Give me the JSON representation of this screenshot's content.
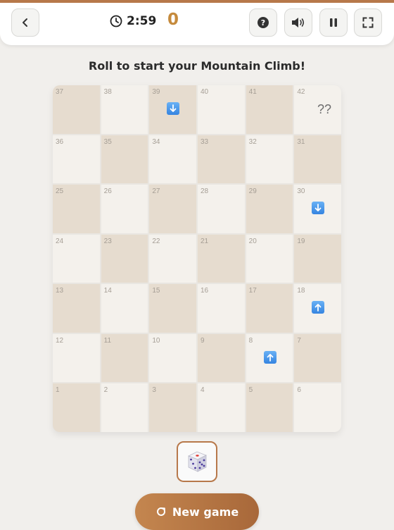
{
  "header": {
    "timer": "2:59",
    "score": "0",
    "back_icon": "chevron-left-icon",
    "help_icon": "question-icon",
    "sound_icon": "speaker-icon",
    "pause_icon": "pause-icon",
    "fullscreen_icon": "fullscreen-icon"
  },
  "message": "Roll to start your Mountain Climb!",
  "board": {
    "rows": [
      [
        {
          "n": "37",
          "dark": true
        },
        {
          "n": "38",
          "dark": false
        },
        {
          "n": "39",
          "dark": true,
          "arrow": "down"
        },
        {
          "n": "40",
          "dark": false
        },
        {
          "n": "41",
          "dark": true
        },
        {
          "n": "42",
          "dark": false,
          "label": "??"
        }
      ],
      [
        {
          "n": "36",
          "dark": false
        },
        {
          "n": "35",
          "dark": true
        },
        {
          "n": "34",
          "dark": false
        },
        {
          "n": "33",
          "dark": true
        },
        {
          "n": "32",
          "dark": false
        },
        {
          "n": "31",
          "dark": true
        }
      ],
      [
        {
          "n": "25",
          "dark": true
        },
        {
          "n": "26",
          "dark": false
        },
        {
          "n": "27",
          "dark": true
        },
        {
          "n": "28",
          "dark": false
        },
        {
          "n": "29",
          "dark": true
        },
        {
          "n": "30",
          "dark": false,
          "arrow": "down"
        }
      ],
      [
        {
          "n": "24",
          "dark": false
        },
        {
          "n": "23",
          "dark": true
        },
        {
          "n": "22",
          "dark": false
        },
        {
          "n": "21",
          "dark": true
        },
        {
          "n": "20",
          "dark": false
        },
        {
          "n": "19",
          "dark": true
        }
      ],
      [
        {
          "n": "13",
          "dark": true
        },
        {
          "n": "14",
          "dark": false
        },
        {
          "n": "15",
          "dark": true
        },
        {
          "n": "16",
          "dark": false
        },
        {
          "n": "17",
          "dark": true
        },
        {
          "n": "18",
          "dark": false,
          "arrow": "up"
        }
      ],
      [
        {
          "n": "12",
          "dark": false
        },
        {
          "n": "11",
          "dark": true
        },
        {
          "n": "10",
          "dark": false
        },
        {
          "n": "9",
          "dark": true
        },
        {
          "n": "8",
          "dark": false,
          "arrow": "up"
        },
        {
          "n": "7",
          "dark": true
        }
      ],
      [
        {
          "n": "1",
          "dark": true
        },
        {
          "n": "2",
          "dark": false
        },
        {
          "n": "3",
          "dark": true
        },
        {
          "n": "4",
          "dark": false
        },
        {
          "n": "5",
          "dark": true
        },
        {
          "n": "6",
          "dark": false
        }
      ]
    ]
  },
  "dice_icon": "dice-icon",
  "new_game": {
    "label": "New game",
    "icon": "restart-icon"
  },
  "colors": {
    "accent": "#b7784a",
    "score": "#c58a3c",
    "dark_cell": "#e6dccf",
    "light_cell": "#f4f1ec",
    "arrow": "#3584e0"
  }
}
